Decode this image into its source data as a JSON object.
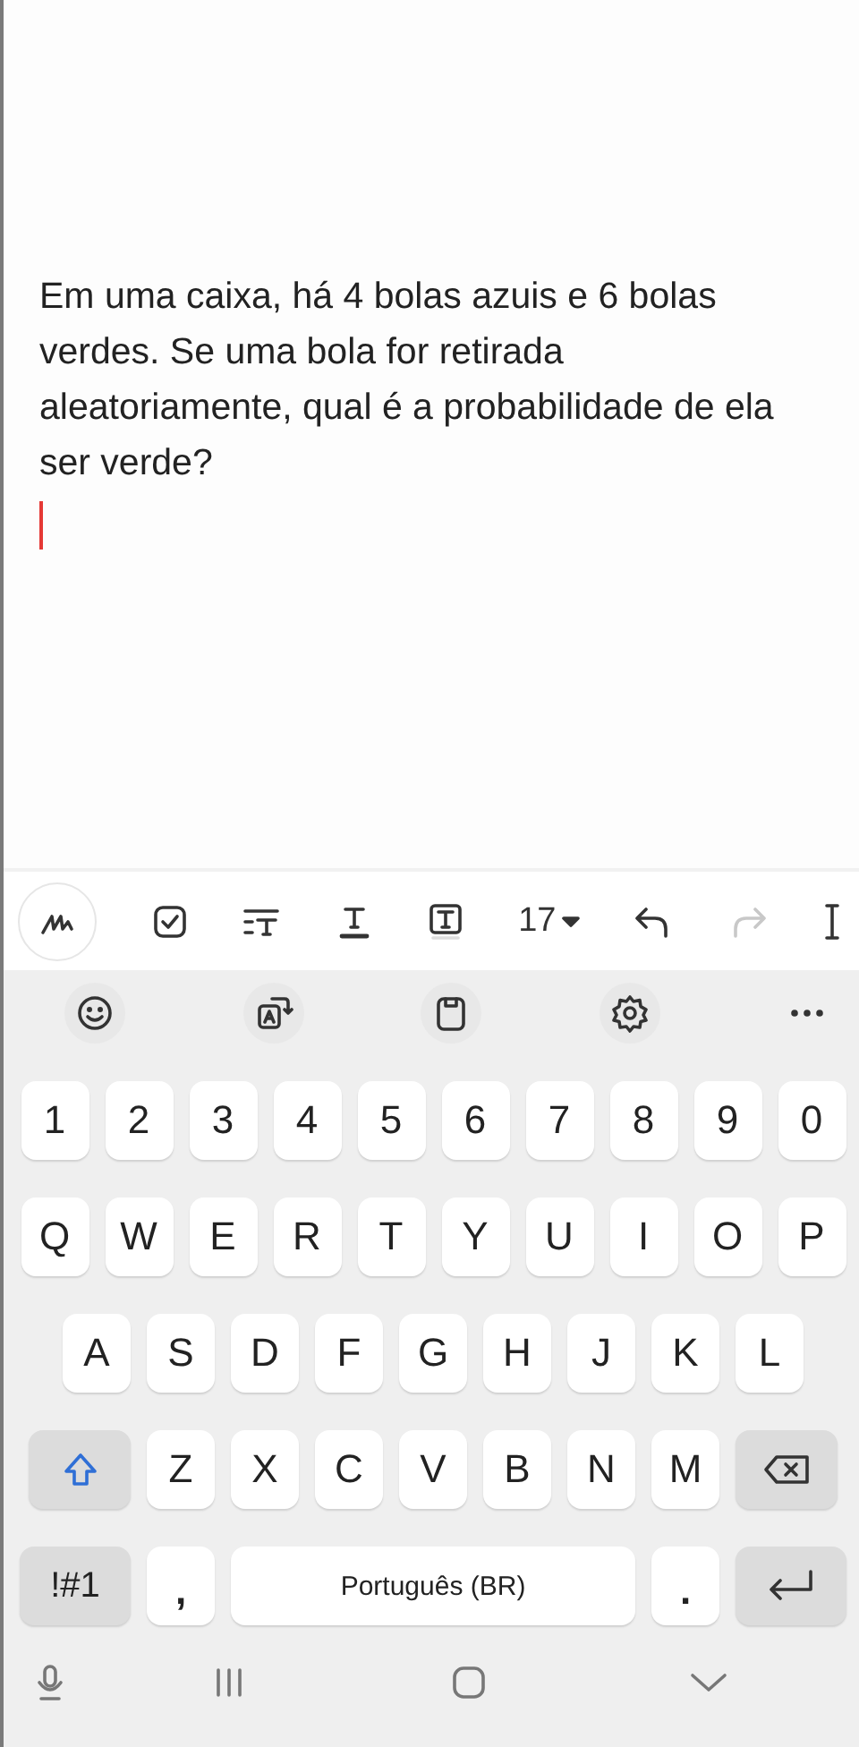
{
  "note": {
    "text": "Em uma caixa, há 4 bolas azuis e 6 bolas verdes. Se uma bola for retirada aleatoriamente, qual é a probabilidade de ela ser verde?",
    "cursor": true
  },
  "toolbar": [
    {
      "kind": "handwriting",
      "active": true
    },
    {
      "kind": "checkbox"
    },
    {
      "kind": "paragraph-style"
    },
    {
      "kind": "text-color"
    },
    {
      "kind": "text-background"
    },
    {
      "kind": "font-size",
      "label": "17"
    },
    {
      "kind": "undo",
      "disabled": false
    },
    {
      "kind": "redo",
      "disabled": true
    },
    {
      "kind": "more"
    }
  ],
  "suggestion_bar": [
    {
      "kind": "emoji"
    },
    {
      "kind": "translate"
    },
    {
      "kind": "clipboard"
    },
    {
      "kind": "settings"
    },
    {
      "kind": "more"
    }
  ],
  "keyboard": {
    "key_rows": [
      {
        "keys": [
          {
            "label": "1"
          },
          {
            "label": "2"
          },
          {
            "label": "3"
          },
          {
            "label": "4"
          },
          {
            "label": "5"
          },
          {
            "label": "6"
          },
          {
            "label": "7"
          },
          {
            "label": "8"
          },
          {
            "label": "9"
          },
          {
            "label": "0"
          }
        ]
      },
      {
        "keys": [
          {
            "label": "Q"
          },
          {
            "label": "W"
          },
          {
            "label": "E"
          },
          {
            "label": "R"
          },
          {
            "label": "T"
          },
          {
            "label": "Y"
          },
          {
            "label": "U"
          },
          {
            "label": "I"
          },
          {
            "label": "O"
          },
          {
            "label": "P"
          }
        ]
      },
      {
        "keys": [
          {
            "label": "A"
          },
          {
            "label": "S"
          },
          {
            "label": "D"
          },
          {
            "label": "F"
          },
          {
            "label": "G"
          },
          {
            "label": "H"
          },
          {
            "label": "J"
          },
          {
            "label": "K"
          },
          {
            "label": "L"
          }
        ]
      },
      {
        "keys": [
          {
            "kind": "shift",
            "on": true
          },
          {
            "label": "Z"
          },
          {
            "label": "X"
          },
          {
            "label": "C"
          },
          {
            "label": "V"
          },
          {
            "label": "B"
          },
          {
            "label": "N"
          },
          {
            "label": "M"
          },
          {
            "kind": "backspace"
          }
        ]
      },
      {
        "keys": [
          {
            "kind": "symbols",
            "label": "!#1"
          },
          {
            "kind": "punct",
            "label": ","
          },
          {
            "kind": "space",
            "label": "Português (BR)"
          },
          {
            "kind": "punct",
            "label": "."
          },
          {
            "kind": "enter"
          }
        ]
      }
    ]
  },
  "nav_bar": [
    {
      "kind": "mic"
    },
    {
      "kind": "recents"
    },
    {
      "kind": "home"
    },
    {
      "kind": "hide-keyboard"
    }
  ]
}
